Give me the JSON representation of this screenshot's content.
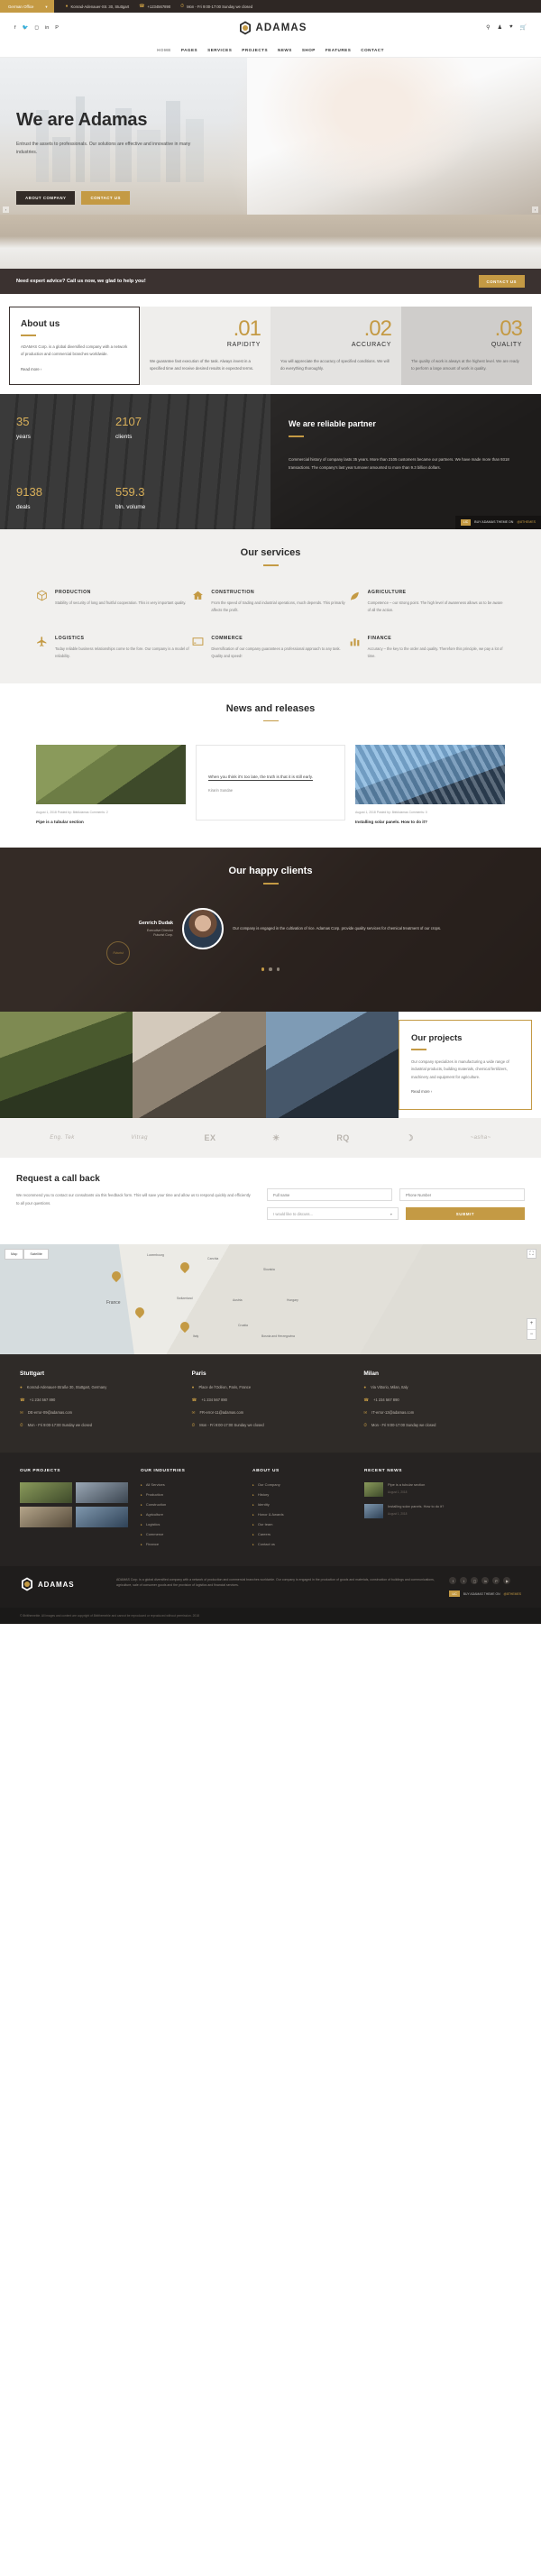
{
  "topbar": {
    "office_label": "German Office",
    "address": "Konrad-Adenauer-Str. 30, Stuttgart",
    "phone": "+1234567890",
    "hours": "Mon - Fri 9:00-17:00 Sunday we closed"
  },
  "header": {
    "brand": "ADAMAS",
    "social": [
      "facebook-icon",
      "twitter-icon",
      "instagram-icon",
      "linkedin-icon",
      "pinterest-icon"
    ],
    "icons": [
      "search-icon",
      "user-icon",
      "heart-icon",
      "cart-icon"
    ]
  },
  "nav": {
    "items": [
      "HOME",
      "PAGES",
      "SERVICES",
      "PROJECTS",
      "NEWS",
      "SHOP",
      "FEATURES",
      "CONTACT"
    ],
    "active": "HOME"
  },
  "hero": {
    "title": "We are Adamas",
    "subtitle": "Entrust the assets to professionals. Our solutions are effective and innovative in many industries.",
    "btn_primary": "ABOUT COMPANY",
    "btn_secondary": "CONTACT US",
    "prev": "‹",
    "next": "›"
  },
  "advice": {
    "text": "Need expert advice? Call us now, we glad to help you!",
    "button": "CONTACT US"
  },
  "about": {
    "title": "About us",
    "text": "ADAMAS Corp. is a global diversified company with a network of production and commercial branches worldwide.",
    "readmore": "Read more",
    "cards": [
      {
        "num": ".01",
        "label": "RAPIDITY",
        "text": "We guarantee fast execution of the task. Always invest in a specified time and receive desired results in expected terms."
      },
      {
        "num": ".02",
        "label": "ACCURACY",
        "text": "You will appreciate the accuracy of specified conditions. We will do everything thoroughly."
      },
      {
        "num": ".03",
        "label": "QUALITY",
        "text": "The quality of work is always at the highest level. We are ready to perform a large amount of work in quality."
      }
    ]
  },
  "stats": {
    "items": [
      {
        "value": "35",
        "label": "years"
      },
      {
        "value": "2107",
        "label": "clients"
      },
      {
        "value": "9138",
        "label": "deals"
      },
      {
        "value": "559.3",
        "label": "bln. volume"
      }
    ],
    "title": "We are reliable partner",
    "text": "Commercial history of company lasts 35 years. More than 2105 customers became our partners. We have made more than 9318 transactions. The company's last year turnover amounted to more than 9.3 billion dollars.",
    "badge_lic": "LIC",
    "badge_buy": "BUY ADAMAS THEME ON",
    "badge_tf": "@8THEMES"
  },
  "services": {
    "title": "Our services",
    "items": [
      {
        "icon": "box-icon",
        "title": "PRODUCTION",
        "text": "Stability of security of long and fruitful cooperation. This is very important quality."
      },
      {
        "icon": "home-icon",
        "title": "CONSTRUCTION",
        "text": "From the speed of trading and industrial operations, much depends. This primarily affects the profit."
      },
      {
        "icon": "leaf-icon",
        "title": "AGRICULTURE",
        "text": "Competence – our strong point. The high level of awareness allows us to be aware of all the action."
      },
      {
        "icon": "plane-icon",
        "title": "LOGISTICS",
        "text": "Today reliable business relationships come to the fore. Our company is a model of reliability."
      },
      {
        "icon": "card-icon",
        "title": "COMMERCE",
        "text": "Diversification of our company guarantees a professional approach to any task. Quality and speed!"
      },
      {
        "icon": "chart-icon",
        "title": "FINANCE",
        "text": "Accuracy – the key to the order and quality. Therefore this principle, we pay a lot of time."
      }
    ]
  },
  "news": {
    "title": "News and releases",
    "cards": [
      {
        "type": "image",
        "thumb": "pipe-photo",
        "meta": "August 1, 2018   Posted by: 8bitAdamas   Comments: 2",
        "title": "Pipe is a tubular section"
      },
      {
        "type": "quote",
        "quote": "When you think it's too late, the truth is that it is still early.",
        "author": "Kirarin Sundae"
      },
      {
        "type": "image",
        "thumb": "solar-photo",
        "meta": "August 1, 2018   Posted by: 8bitAdamas   Comments: 0",
        "title": "Installing solar panels. How to do it?"
      }
    ]
  },
  "clients": {
    "title": "Our happy clients",
    "name": "Genrich Dudak",
    "role": "Executive Director",
    "company": "Futurist Corp.",
    "text": "Our company is engaged in the cultivation of rice. Adamas Corp. provide quality services for chemical treatment of our crops.",
    "seal": "Futurist"
  },
  "projects": {
    "title": "Our projects",
    "text": "Our company specializes in manufacturing a wide range of industrial products, building materials, chemical fertilizers, machinery and equipment for agriculture.",
    "readmore": "Read more"
  },
  "partners": {
    "logos": [
      "Eng. Tek",
      "Vitrag",
      "EX",
      "☀",
      "RQ",
      "☽",
      "~asha~"
    ]
  },
  "callback": {
    "title": "Request a call back",
    "text": "We recommend you to contact our consultants via this feedback form. This will save your time and allow us to respond quickly and efficiently to all your questions.",
    "fullname_placeholder": "Full name",
    "phone_placeholder": "Phone Number",
    "select_value": "I would like to discuss...",
    "submit": "SUBMIT"
  },
  "map": {
    "tab_map": "Map",
    "tab_satellite": "Satellite",
    "labels": [
      "Luxembourg",
      "Czechia",
      "Slovakia",
      "France",
      "Switzerland",
      "Austria",
      "Hungary",
      "Croatia",
      "Italy",
      "Bosnia and Herzegovina"
    ],
    "zoom_in": "+",
    "zoom_out": "−",
    "fullscreen": "⛶"
  },
  "offices": [
    {
      "city": "Stuttgart",
      "address": "Konrad-Adenauer-Straße 30, Stuttgart, Germany",
      "phone": "+1 234 567 890",
      "email": "DE-error-09@adamas.com",
      "hours": "Mon - Fri 9:00-17:00 Sunday we closed"
    },
    {
      "city": "Paris",
      "address": "Place de l'Odéon, Paris, France",
      "phone": "+1 234 567 890",
      "email": "FR-error-11@adamas.com",
      "hours": "Mon - Fri 9:00-17:00 Sunday we closed"
    },
    {
      "city": "Milan",
      "address": "Via Vittorio, Milan, Italy",
      "phone": "+1 234 567 890",
      "email": "IT-error-13@adamas.com",
      "hours": "Mon - Fri 9:00-17:00 Sunday we closed"
    }
  ],
  "footer": {
    "projects_title": "OUR PROJECTS",
    "industries_title": "OUR INDUSTRIES",
    "industries": [
      "All Services",
      "Production",
      "Construction",
      "Agriculture",
      "Logistics",
      "Commerce",
      "Finance"
    ],
    "about_title": "ABOUT US",
    "about": [
      "Our Company",
      "History",
      "Identity",
      "Honor & Awards",
      "Our team",
      "Careers",
      "Contact us"
    ],
    "recent_title": "RECENT NEWS",
    "recent": [
      {
        "title": "Pipe is a tubular section",
        "date": "August 1, 2018"
      },
      {
        "title": "Installing solar panels. How to do it?",
        "date": "August 1, 2018"
      }
    ]
  },
  "bottom": {
    "brand": "ADAMAS",
    "text": "ADAMAS Corp. is a global diversified company with a network of production and commercial branches worldwide. Our company is engaged in the production of goods and materials, construction of buildings and communications, agriculture, sale of consumer goods and the provision of logistics and financial services.",
    "lic": "LIC",
    "buy": "BUY ADAMAS THEME ON",
    "tf": "@8THEMES",
    "copyright": "© 8bitthemeble. All images and content are copyright of 8bitthemeble and cannot be reproduced or reproduced without permission. 2018"
  }
}
